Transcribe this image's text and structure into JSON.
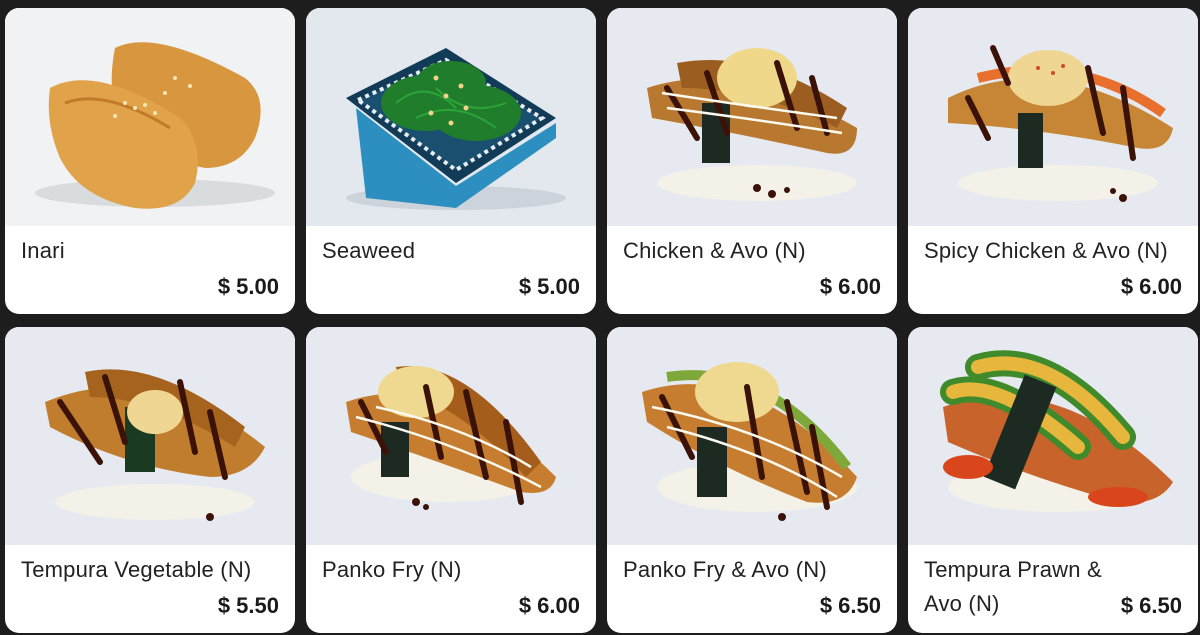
{
  "currency": "$",
  "items": [
    {
      "name": "Inari",
      "price": "$ 5.00",
      "image": "inari-sushi-photo"
    },
    {
      "name": "Seaweed",
      "price": "$ 5.00",
      "image": "seaweed-salad-photo"
    },
    {
      "name": "Chicken & Avo (N)",
      "price": "$ 6.00",
      "image": "chicken-avo-nigiri-photo"
    },
    {
      "name": "Spicy Chicken & Avo (N)",
      "price": "$ 6.00",
      "image": "spicy-chicken-avo-nigiri-photo"
    },
    {
      "name": "Tempura Vegetable (N)",
      "price": "$ 5.50",
      "image": "tempura-vegetable-nigiri-photo"
    },
    {
      "name": "Panko Fry (N)",
      "price": "$ 6.00",
      "image": "panko-fry-nigiri-photo"
    },
    {
      "name": "Panko Fry & Avo (N)",
      "price": "$ 6.50",
      "image": "panko-fry-avo-nigiri-photo"
    },
    {
      "name": "Tempura Prawn & Avo (N)",
      "price": "$ 6.50",
      "image": "tempura-prawn-avo-nigiri-photo"
    }
  ],
  "colors": {
    "background": "#1d1d1d",
    "card": "#ffffff",
    "photo_backdrop": "#e5e9ee"
  }
}
